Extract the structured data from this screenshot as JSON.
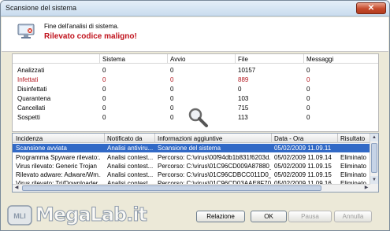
{
  "window": {
    "title": "Scansione del sistema",
    "close_glyph": "✕"
  },
  "header": {
    "line1": "Fine dell'analisi di sistema.",
    "line2": "Rilevato codice maligno!",
    "icon": "monitor-icon"
  },
  "stats": {
    "columns": [
      "",
      "Sistema",
      "Avvio",
      "File",
      "Messaggi"
    ],
    "rows": [
      {
        "label": "Analizzati",
        "values": [
          "0",
          "0",
          "10157",
          "0"
        ]
      },
      {
        "label": "Infettati",
        "values": [
          "0",
          "0",
          "889",
          "0"
        ]
      },
      {
        "label": "Disinfettati",
        "values": [
          "0",
          "0",
          "0",
          "0"
        ]
      },
      {
        "label": "Quarantena",
        "values": [
          "0",
          "0",
          "103",
          "0"
        ]
      },
      {
        "label": "Cancellati",
        "values": [
          "0",
          "0",
          "715",
          "0"
        ]
      },
      {
        "label": "Sospetti",
        "values": [
          "0",
          "0",
          "113",
          "0"
        ]
      }
    ]
  },
  "log": {
    "columns": [
      "Incidenza",
      "Notificato da",
      "Informazioni aggiuntive",
      "Data - Ora",
      "Risultato"
    ],
    "rows": [
      [
        "Scansione avviata",
        "Analisi antiviru...",
        "Scansione del sistema",
        "05/02/2009 11.09.11",
        ""
      ],
      [
        "Programma Spyware rilevato:...",
        "Analisi contest...",
        "Percorso: C:\\virus\\00f94db1b831f6203d...",
        "05/02/2009 11.09.14",
        "Eliminato"
      ],
      [
        "Virus rilevato: Generic Trojan",
        "Analisi contest...",
        "Percorso: C:\\virus\\01C96CD009A87880_1...",
        "05/02/2009 11.09.15",
        "Eliminato"
      ],
      [
        "Rilevato adware: Adware/Wm...",
        "Analisi contest...",
        "Percorso: C:\\virus\\01C96CDBCC011D0_...",
        "05/02/2009 11.09.15",
        "Eliminato"
      ],
      [
        "Virus rilevato: Trj/Downloader...",
        "Analisi contest...",
        "Percorso: C:\\virus\\01C96CD03AAE8F70_...",
        "05/02/2009 11.09.16",
        "Eliminato"
      ]
    ],
    "selected_index": 0
  },
  "buttons": {
    "relazione": "Relazione",
    "ok": "OK",
    "pausa": "Pausa",
    "annulla": "Annulla"
  },
  "watermark": {
    "text": "MegaLab.it",
    "logo": "mli-logo"
  },
  "colors": {
    "alert_red": "#c0121c",
    "selection_blue": "#3169c6",
    "dialog_bg": "#ece9d8"
  }
}
